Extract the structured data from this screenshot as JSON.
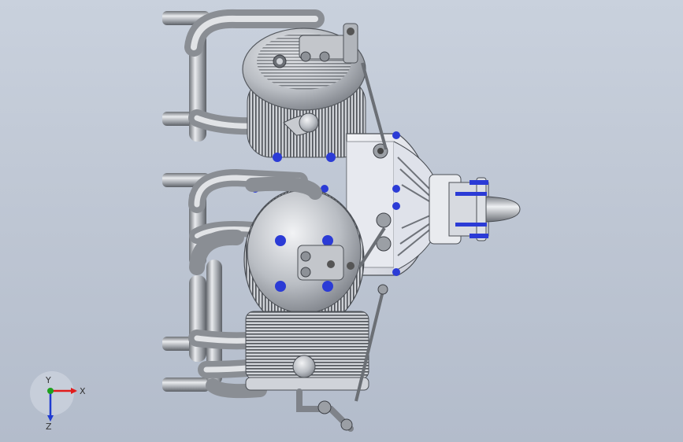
{
  "viewport": {
    "background_top": "#c9d1dd",
    "background_bottom": "#b3bccb"
  },
  "model": {
    "steel_color": "#a7abb0",
    "bolt_color": "#2b3bd6",
    "crankcase_color": "#e7e9ef"
  },
  "triad": {
    "x_label": "X",
    "y_label": "Y",
    "z_label": "Z",
    "x_color": "#e11c1c",
    "y_color": "#1ea01e",
    "z_color": "#1f3bd1"
  }
}
